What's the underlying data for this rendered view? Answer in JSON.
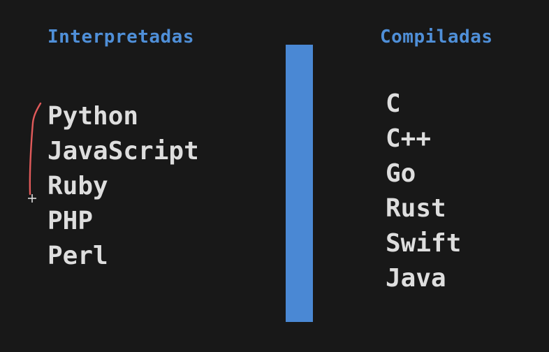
{
  "interpreted": {
    "title": "Interpretadas",
    "items": [
      "Python",
      "JavaScript",
      "Ruby",
      "PHP",
      "Perl"
    ]
  },
  "compiled": {
    "title": "Compiladas",
    "items": [
      "C",
      "C++",
      "Go",
      "Rust",
      "Swift",
      "Java"
    ]
  },
  "colors": {
    "background": "#181818",
    "heading": "#4f8fd8",
    "text": "#dedede",
    "divider": "#4a88d4",
    "annotation": "#e05a5a"
  },
  "annotation": {
    "icon": "crosshair-cursor-icon"
  }
}
